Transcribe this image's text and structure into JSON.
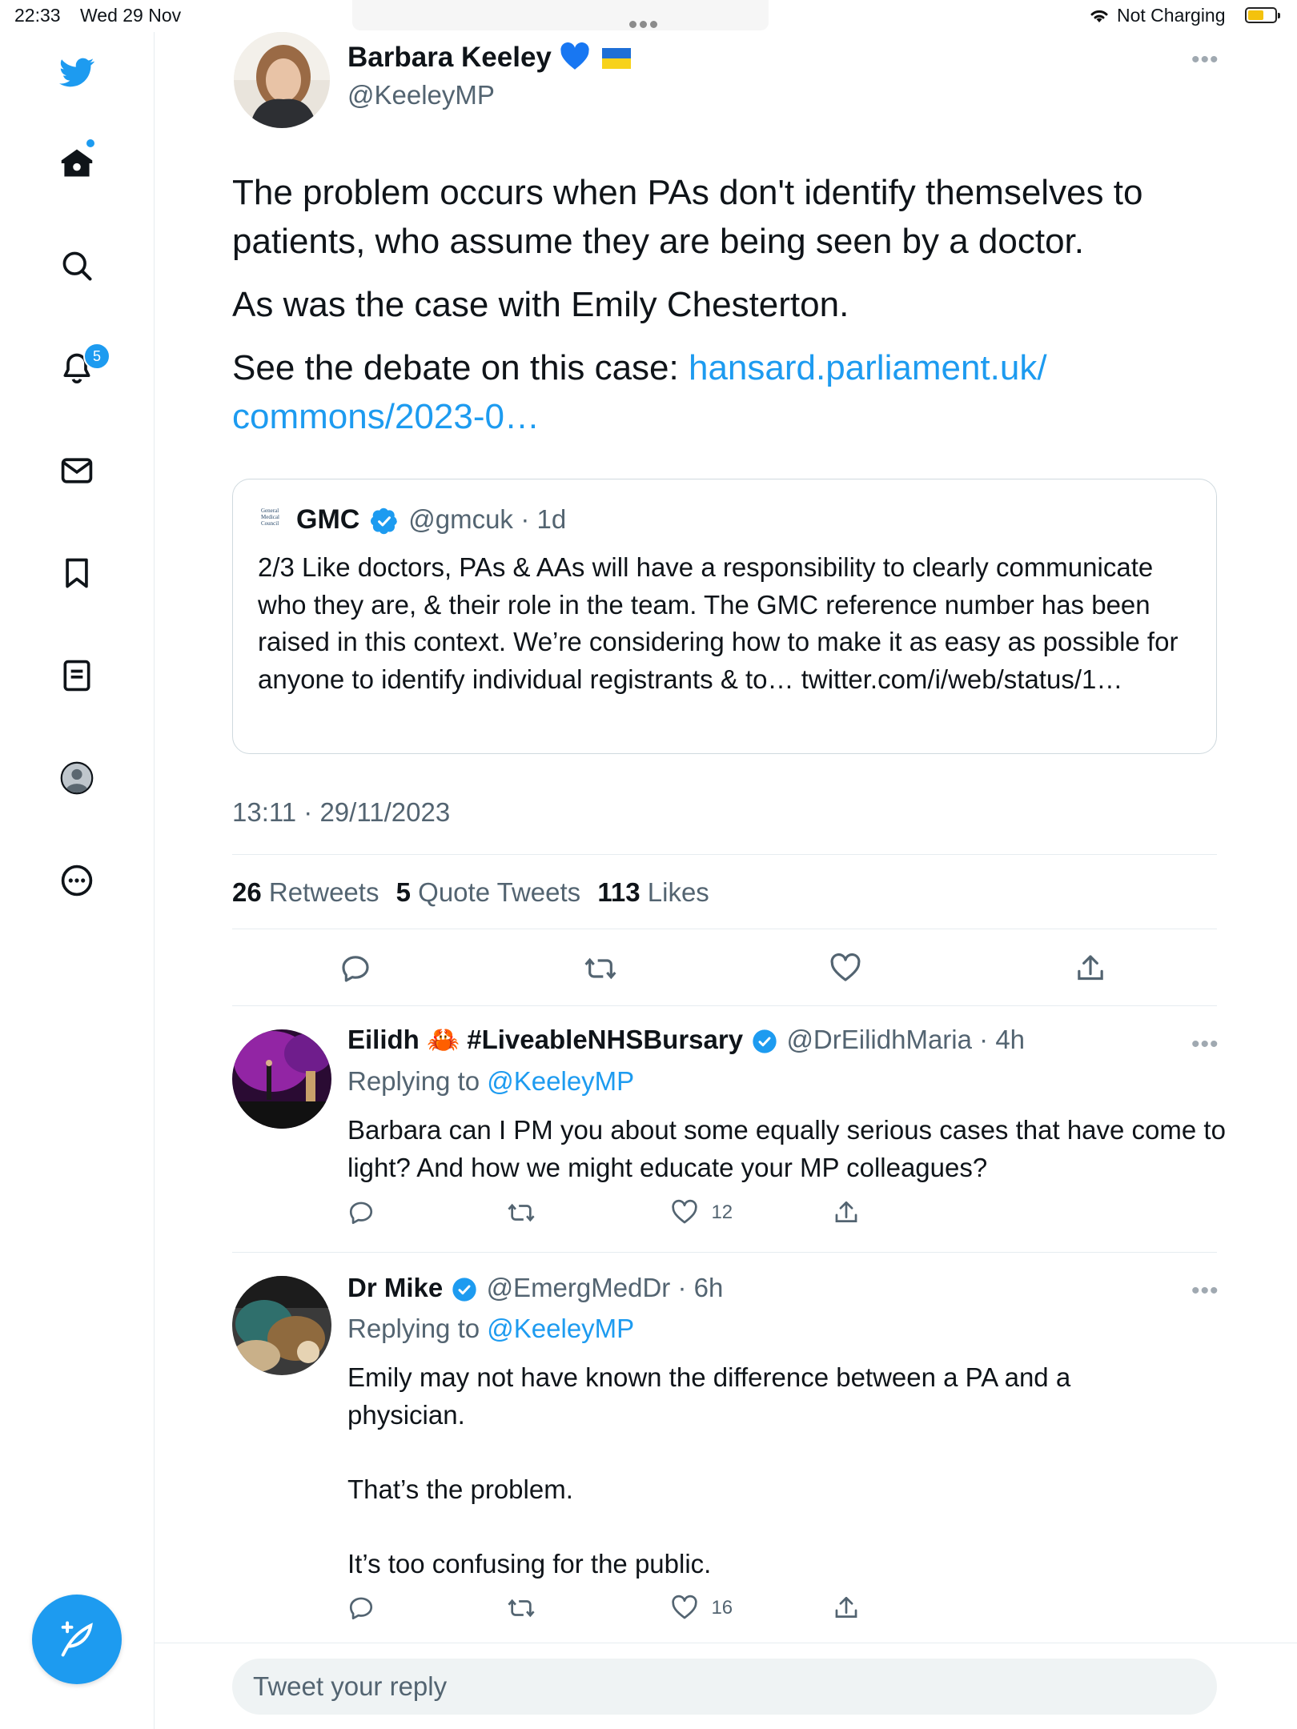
{
  "status_bar": {
    "time": "22:33",
    "date": "Wed 29 Nov",
    "charging": "Not Charging",
    "battery_level": 0.6
  },
  "sidebar": {
    "items": [
      {
        "icon": "twitter-bird-icon"
      },
      {
        "icon": "home-icon"
      },
      {
        "icon": "search-icon"
      },
      {
        "icon": "bell-icon",
        "badge": "5"
      },
      {
        "icon": "mail-icon"
      },
      {
        "icon": "bookmark-icon"
      },
      {
        "icon": "list-icon"
      },
      {
        "icon": "profile-icon"
      },
      {
        "icon": "more-circle-icon"
      }
    ],
    "compose_icon": "feather-plus-icon"
  },
  "tweet": {
    "author": {
      "name": "Barbara Keeley",
      "handle": "@KeeleyMP",
      "emoji": [
        "blue-heart",
        "ukraine-flag"
      ]
    },
    "paragraph1": "The problem occurs when PAs don't identify themselves to patients, who assume they are being seen by a doctor.",
    "paragraph2": "As was the case with Emily Chesterton.",
    "paragraph3_prefix": "See the debate on this case: ",
    "link_line1": "hansard.parliament.uk/",
    "link_line2": "commons/2023-0…",
    "quote": {
      "logo_text": "General Medical Council",
      "name": "GMC",
      "handle": "@gmcuk",
      "time": "· 1d",
      "text": "2/3 Like doctors, PAs & AAs will have a responsibility to clearly communicate who they are, & their role in the team. The GMC reference number has been raised in this context. We’re considering how to make it as easy as possible for anyone to identify individual registrants & to… twitter.com/i/web/status/1…"
    },
    "timestamp": "13:11 · 29/11/2023",
    "stats": {
      "retweets_count": "26",
      "retweets_label": "Retweets",
      "quotes_count": "5",
      "quotes_label": "Quote Tweets",
      "likes_count": "113",
      "likes_label": "Likes"
    }
  },
  "replies": [
    {
      "name": "Eilidh 🦀 #LiveableNHSBursary",
      "handle": "@DrEilidhMaria",
      "time": "· 4h",
      "replying_prefix": "Replying to ",
      "replying_to": "@KeeleyMP",
      "text": "Barbara can I PM you about some equally serious cases that have come to light? And how we might educate your MP colleagues?",
      "likes": "12"
    },
    {
      "name": "Dr Mike",
      "handle": "@EmergMedDr",
      "time": "· 6h",
      "replying_prefix": "Replying to ",
      "replying_to": "@KeeleyMP",
      "text_lines": [
        "Emily may not have known the difference between a PA and a physician.",
        "That’s the problem.",
        "It’s too confusing for the public."
      ],
      "likes": "16"
    }
  ],
  "reply_box": {
    "placeholder": "Tweet your reply"
  },
  "colors": {
    "accent": "#1d9bf0",
    "text": "#0f1419",
    "secondary": "#536471",
    "border": "#e6ecf0"
  }
}
